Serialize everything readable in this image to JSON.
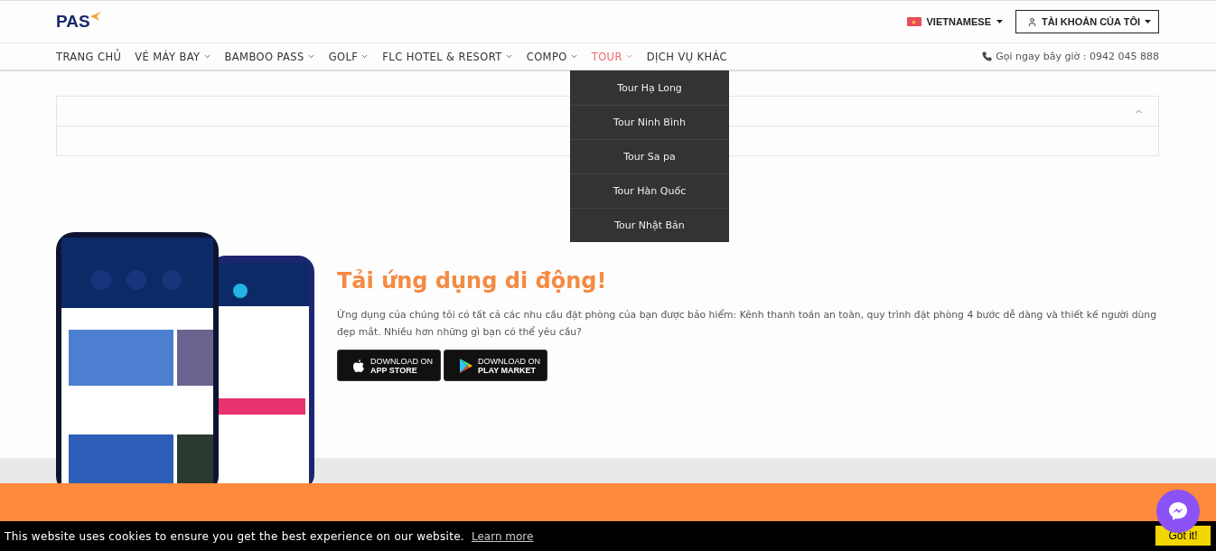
{
  "header": {
    "logo": "PAS",
    "language": {
      "label": "VIETNAMESE"
    },
    "account": {
      "label": "TÀI KHOẢN CỦA TÔI"
    }
  },
  "nav": {
    "items": [
      {
        "label": "TRANG CHỦ",
        "has_menu": false,
        "selected": false
      },
      {
        "label": "VÉ MÁY BAY",
        "has_menu": true,
        "selected": false
      },
      {
        "label": "BAMBOO PASS",
        "has_menu": true,
        "selected": false
      },
      {
        "label": "GOLF",
        "has_menu": true,
        "selected": false
      },
      {
        "label": "FLC HOTEL & RESORT",
        "has_menu": true,
        "selected": false
      },
      {
        "label": "COMPO",
        "has_menu": true,
        "selected": false
      },
      {
        "label": "TOUR",
        "has_menu": true,
        "selected": true
      },
      {
        "label": "DỊCH VỤ KHÁC",
        "has_menu": false,
        "selected": false
      }
    ],
    "phone": "Gọi ngay bây giờ : 0942 045 888",
    "dropdown": [
      "Tour Hạ Long",
      "Tour Ninh Bình",
      "Tour Sa pa",
      "Tour Hàn Quốc",
      "Tour Nhật Bản"
    ]
  },
  "accordion": {
    "expanded": true
  },
  "app_section": {
    "title": "Tải ứng dụng di động!",
    "text": "Ứng dụng của chúng tôi có tất cả các nhu cầu đặt phòng của bạn được bảo hiểm: Kênh thanh toán an toàn, quy trình đặt phòng 4 bước dễ dàng và thiết kế người dùng đẹp mắt. Nhiều hơn những gì bạn có thể yêu cầu?",
    "buttons": [
      {
        "kind": "apple",
        "line1": "DOWNLOAD ON",
        "line2": "APP STORE"
      },
      {
        "kind": "play",
        "line1": "DOWNLOAD ON",
        "line2": "PLAY MARKET"
      }
    ]
  },
  "cookie_bar": {
    "text": "This website uses cookies to ensure you get the best experience on our website.",
    "link": "Learn more",
    "button": "Got it!"
  }
}
